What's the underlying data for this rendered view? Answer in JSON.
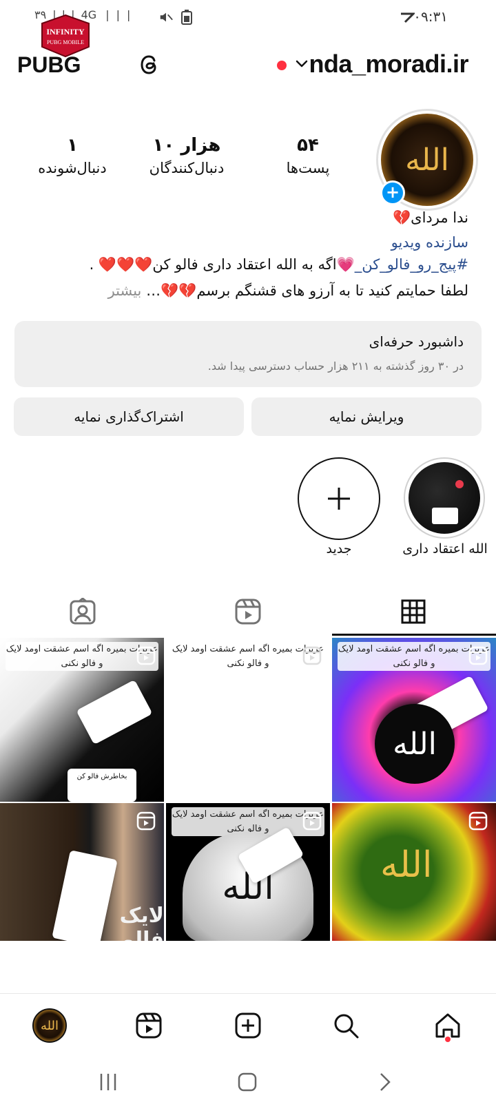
{
  "status_bar": {
    "time": "۰۹:۳۱",
    "left_text": "۳۹ ❘❘❘ 4G ❘❘❘"
  },
  "header": {
    "username": "nda_moradi.ir",
    "overlay_logo": "PUBG"
  },
  "profile": {
    "stats": [
      {
        "value": "۵۴",
        "label": "پست‌ها"
      },
      {
        "value": "۱۰ هزار",
        "label": "دنبال‌کنندگان"
      },
      {
        "value": "۱",
        "label": "دنبال‌شونده"
      }
    ],
    "name": "ندا مردای💔",
    "category": "سازنده ویدیو",
    "bio_hashtag": "#پیج_رو_فالو_کن_💗",
    "bio_line1_rest": "اگه به الله اعتقاد داری فالو کن❤️❤️❤️ .",
    "bio_line2": "لطفا حمایتم کنید تا به آرزو های قشنگم برسم💔💔…",
    "bio_more": " بیشتر"
  },
  "dashboard": {
    "title": "داشبورد حرفه‌ای",
    "subtitle": "در ۳۰ روز گذشته به ۲۱۱ هزار حساب دسترسی پیدا شد."
  },
  "buttons": {
    "edit": "ویرایش نمایه",
    "share": "اشتراک‌گذاری نمایه"
  },
  "highlights": [
    {
      "label": "الله اعتقاد داری"
    },
    {
      "label": "جدید"
    }
  ],
  "posts": [
    {
      "caption": "عزیزات بمیره اگه اسم عشقت اومد لایک و فالو نکنی"
    },
    {
      "caption": "عزیزات بمیره اگه اسم عشقت اومد لایک و فالو نکنی"
    },
    {
      "caption": "عزیزات بمیره اگه اسم عشقت اومد لایک و فالو نکنی"
    },
    {
      "caption": ""
    },
    {
      "caption": "عزیزات بمیره اگه اسم عشقت اومد لایک و فالو نکنی"
    },
    {
      "caption": ""
    }
  ],
  "post_overlay_text": {
    "note_follow": "بخاطرش فالو کن",
    "like_follow": "لایک فالو",
    "allah": "الله"
  },
  "colors": {
    "accent_blue": "#0095f6",
    "link_blue": "#2b4e8e",
    "notification_red": "#ff3040",
    "surface_gray": "#efefef"
  }
}
